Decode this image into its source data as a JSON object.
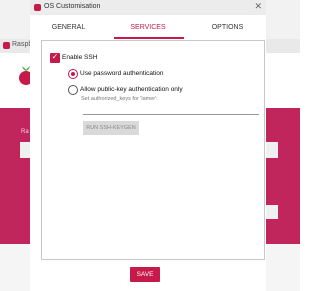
{
  "background_app": {
    "title": "Raspberr",
    "label_left": "Ra"
  },
  "dialog": {
    "title": "OS Customisation",
    "close_glyph": "✕"
  },
  "tabs": [
    {
      "label": "GENERAL",
      "active": false
    },
    {
      "label": "SERVICES",
      "active": true
    },
    {
      "label": "OPTIONS",
      "active": false
    }
  ],
  "services": {
    "enable_ssh": {
      "label": "Enable SSH",
      "checked": true
    },
    "password_auth": {
      "label": "Use password authentication",
      "selected": true
    },
    "pubkey_auth": {
      "label": "Allow public-key authentication only",
      "selected": false,
      "hint": "Set authorized_keys for 'lamer':"
    },
    "authorized_keys_value": "",
    "keygen_button": "RUN SSH-KEYGEN"
  },
  "save_button": "SAVE",
  "colors": {
    "accent": "#c51a4a",
    "magenta_bg": "#c0265c"
  }
}
